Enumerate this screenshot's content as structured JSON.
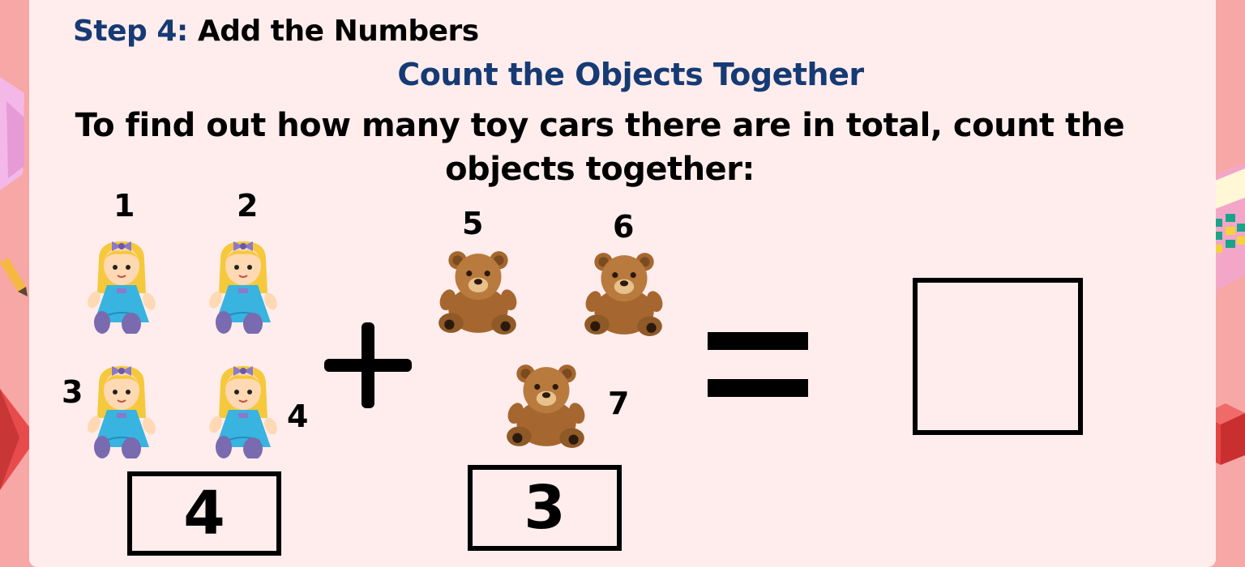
{
  "header": {
    "step_label": "Step 4:",
    "step_text": " Add the Numbers",
    "subtitle": "Count the Objects Together",
    "instruction": "To find out how many toy cars there are in total, count the objects together:"
  },
  "dolls": {
    "labels": [
      "1",
      "2",
      "3",
      "4"
    ],
    "count_box": "4"
  },
  "bears": {
    "labels": [
      "5",
      "6",
      "7"
    ],
    "count_box": "3"
  },
  "answer_box": "",
  "colors": {
    "title_blue": "#163a73",
    "background": "#f7a7a5",
    "card": "#ffeded"
  },
  "icons": [
    "doll-icon",
    "teddy-bear-icon",
    "plus-icon",
    "equals-icon",
    "pencil-icon",
    "calculator-icon",
    "cube-icon"
  ]
}
